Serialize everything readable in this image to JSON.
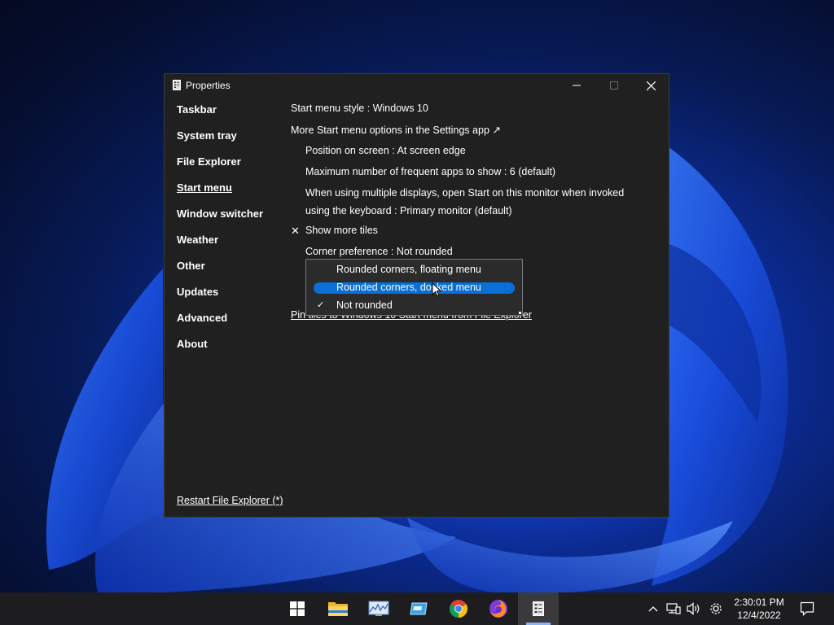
{
  "window": {
    "title": "Properties",
    "controls": {
      "minimize_icon": "minimize-icon",
      "maximize_icon": "maximize-icon",
      "close_icon": "close-icon"
    }
  },
  "sidebar": {
    "items": [
      {
        "label": "Taskbar",
        "active": false
      },
      {
        "label": "System tray",
        "active": false
      },
      {
        "label": "File Explorer",
        "active": false
      },
      {
        "label": "Start menu",
        "active": true
      },
      {
        "label": "Window switcher",
        "active": false
      },
      {
        "label": "Weather",
        "active": false
      },
      {
        "label": "Other",
        "active": false
      },
      {
        "label": "Updates",
        "active": false
      },
      {
        "label": "Advanced",
        "active": false
      },
      {
        "label": "About",
        "active": false
      }
    ],
    "restart_link": "Restart File Explorer (*)"
  },
  "content": {
    "start_menu_style": "Start menu style : Windows 10",
    "more_options": "More Start menu options in the Settings app ↗",
    "position_on_screen": "Position on screen : At screen edge",
    "max_frequent_apps": "Maximum number of frequent apps to show : 6 (default)",
    "multi_display": "When using multiple displays, open Start on this monitor when invoked using the keyboard : Primary monitor (default)",
    "show_more_tiles_mark": "✕",
    "show_more_tiles": "Show more tiles",
    "corner_preference": "Corner preference : Not rounded",
    "pin_tiles_link": "Pin tiles to Windows 10 Start menu from File Explorer"
  },
  "dropdown": {
    "options": [
      {
        "label": "Rounded corners, floating menu",
        "checked": false,
        "highlighted": false
      },
      {
        "label": "Rounded corners, docked menu",
        "checked": false,
        "highlighted": true
      },
      {
        "label": "Not rounded",
        "checked": true,
        "highlighted": false
      }
    ],
    "check_mark": "✓"
  },
  "taskbar": {
    "apps": [
      {
        "name": "start-windows-icon"
      },
      {
        "name": "file-explorer-icon"
      },
      {
        "name": "performance-monitor-icon"
      },
      {
        "name": "app-window-icon"
      },
      {
        "name": "chrome-icon"
      },
      {
        "name": "firefox-icon"
      },
      {
        "name": "properties-app-icon"
      }
    ],
    "clock_time": "2:30:01 PM",
    "clock_date": "12/4/2022"
  },
  "colors": {
    "window_bg": "#202020",
    "accent": "#0a6fd6",
    "taskbar_bg": "#1d1d1f"
  }
}
